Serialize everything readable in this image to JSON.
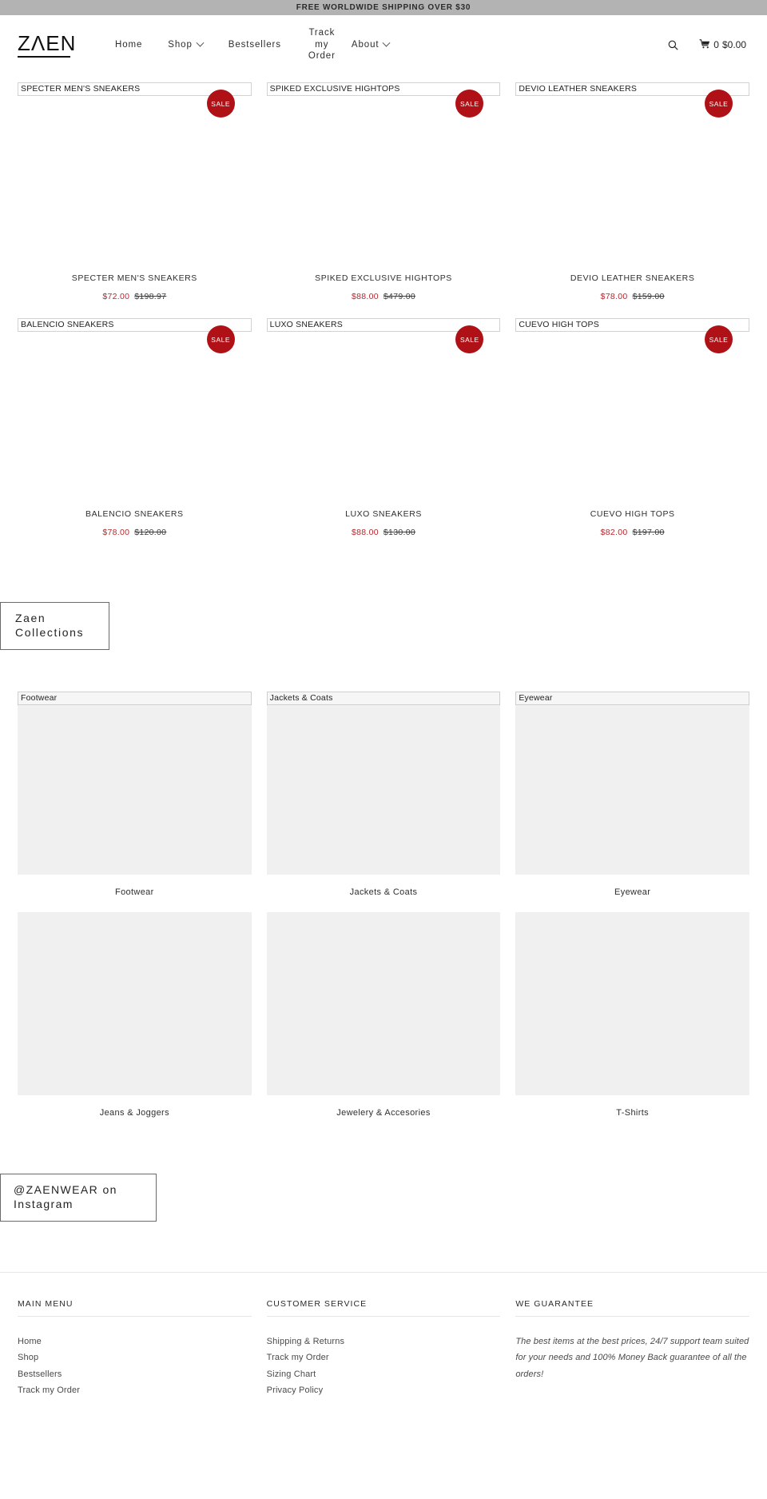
{
  "announcement": {
    "text": "FREE WORLDWIDE SHIPPING OVER $30"
  },
  "header": {
    "logo": "ZΛEN",
    "nav": [
      {
        "label": "Home",
        "has_caret": false
      },
      {
        "label": "Shop",
        "has_caret": true
      },
      {
        "label": "Bestsellers",
        "has_caret": false
      },
      {
        "label": "Track my Order",
        "has_caret": false
      },
      {
        "label": "About",
        "has_caret": true
      }
    ],
    "search_icon": "search-icon",
    "cart_icon": "cart-icon",
    "cart_count": "0",
    "cart_total": "$0.00"
  },
  "products": [
    {
      "alt": "SPECTER MEN'S SNEAKERS",
      "title": "SPECTER MEN'S SNEAKERS",
      "sale_price": "$72.00",
      "old_price": "$198.97",
      "badge": "SALE"
    },
    {
      "alt": "SPIKED EXCLUSIVE HIGHTOPS",
      "title": "SPIKED EXCLUSIVE HIGHTOPS",
      "sale_price": "$88.00",
      "old_price": "$479.00",
      "badge": "SALE"
    },
    {
      "alt": "DEVIO LEATHER SNEAKERS",
      "title": "DEVIO LEATHER SNEAKERS",
      "sale_price": "$78.00",
      "old_price": "$159.00",
      "badge": "SALE"
    },
    {
      "alt": "BALENCIO SNEAKERS",
      "title": "BALENCIO SNEAKERS",
      "sale_price": "$78.00",
      "old_price": "$120.00",
      "badge": "SALE"
    },
    {
      "alt": "LUXO SNEAKERS",
      "title": "LUXO SNEAKERS",
      "sale_price": "$88.00",
      "old_price": "$130.00",
      "badge": "SALE"
    },
    {
      "alt": "CUEVO HIGH TOPS",
      "title": "CUEVO HIGH TOPS",
      "sale_price": "$82.00",
      "old_price": "$197.00",
      "badge": "SALE"
    }
  ],
  "collections_section": {
    "heading": "Zaen Collections",
    "items": [
      {
        "alt": "Footwear",
        "label": "Footwear"
      },
      {
        "alt": "Jackets & Coats",
        "label": "Jackets & Coats"
      },
      {
        "alt": "Eyewear",
        "label": "Eyewear"
      },
      {
        "alt": "",
        "label": "Jeans & Joggers"
      },
      {
        "alt": "",
        "label": "Jewelery & Accesories"
      },
      {
        "alt": "",
        "label": "T-Shirts"
      }
    ]
  },
  "instagram": {
    "heading": "@ZAENWEAR on Instagram"
  },
  "footer": {
    "columns": [
      {
        "title": "MAIN MENU",
        "links": [
          "Home",
          "Shop",
          "Bestsellers",
          "Track my Order"
        ],
        "text": ""
      },
      {
        "title": "CUSTOMER SERVICE",
        "links": [
          "Shipping & Returns",
          "Track my Order",
          "Sizing Chart",
          "Privacy Policy"
        ],
        "text": ""
      },
      {
        "title": "WE GUARANTEE",
        "links": [],
        "text": "The best items at the best prices, 24/7 support team suited for your needs and 100% Money Back guarantee of all the orders!"
      }
    ]
  },
  "colors": {
    "announcement_bg": "#b3b3b3",
    "sale_badge": "#b01116",
    "sale_price": "#b3292f",
    "placeholder_bg": "#f0f0f0"
  }
}
